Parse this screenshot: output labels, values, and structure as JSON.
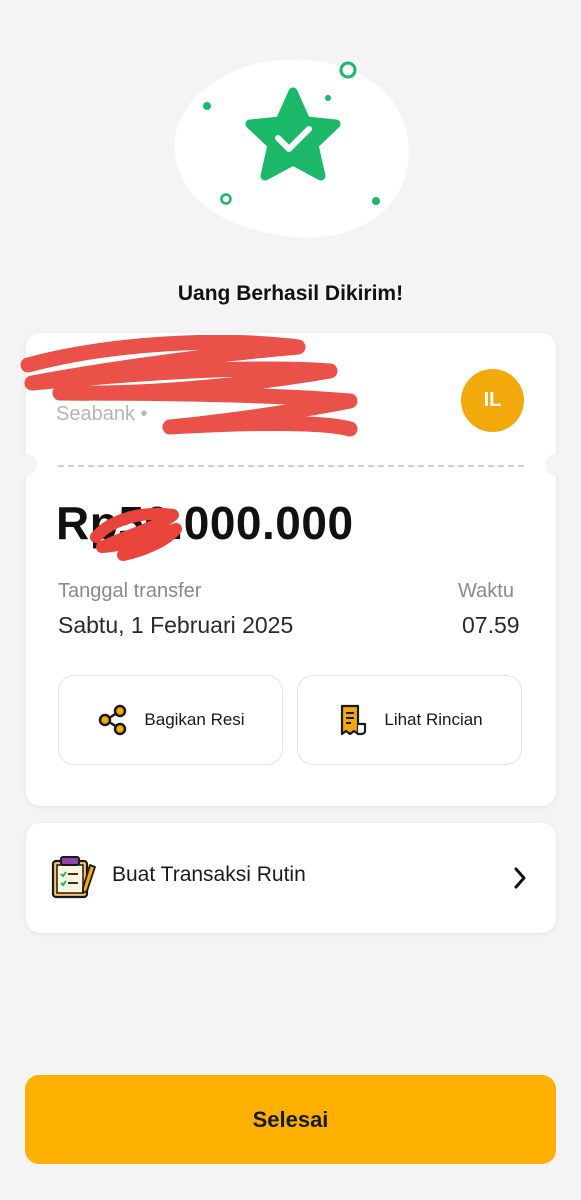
{
  "header": {
    "title": "Uang Berhasil Dikirim!"
  },
  "recipient": {
    "bank": "Seabank •",
    "avatar_initials": "IL"
  },
  "transfer": {
    "amount": "Rp50.000.000",
    "date_label": "Tanggal transfer",
    "date_value": "Sabtu, 1 Februari 2025",
    "time_label": "Waktu",
    "time_value": "07.59"
  },
  "actions": [
    {
      "label": "Bagikan Resi",
      "icon": "share-icon"
    },
    {
      "label": "Lihat Rincian",
      "icon": "receipt-icon"
    }
  ],
  "routine": {
    "label": "Buat Transaksi Rutin",
    "icon": "clipboard-icon"
  },
  "footer": {
    "done_label": "Selesai"
  },
  "colors": {
    "accent": "#fdb000",
    "success": "#1cb86a",
    "avatar": "#f2a90b",
    "redaction": "#e8443b"
  }
}
